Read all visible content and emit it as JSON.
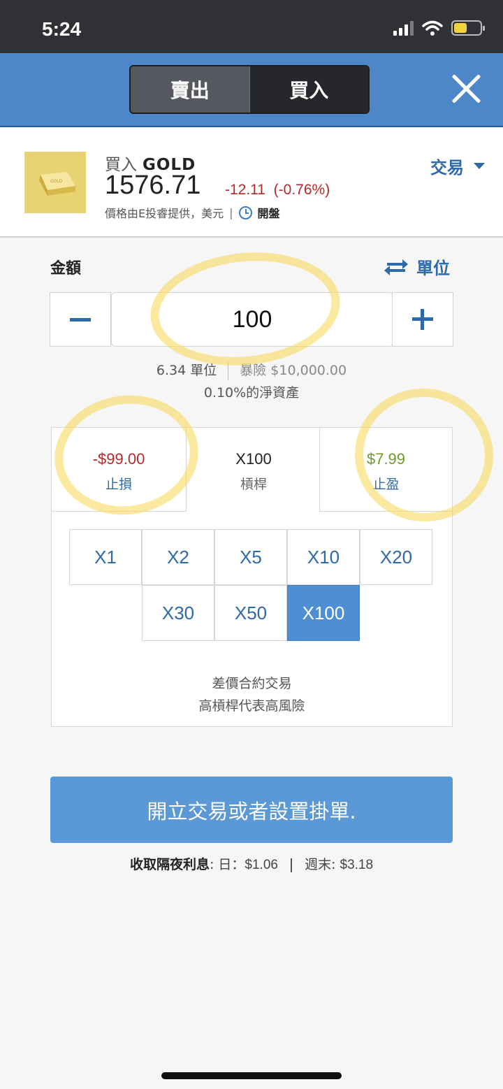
{
  "status_bar": {
    "time": "5:24"
  },
  "header": {
    "sell_label": "賣出",
    "buy_label": "買入"
  },
  "instrument": {
    "action": "買入",
    "symbol": "GOLD",
    "price": "1576.71",
    "change": "-12.11",
    "change_pct": "(-0.76%)",
    "source": "價格由E投睿提供，美元",
    "separator": "|",
    "market_status": "開盤",
    "trade_menu": "交易",
    "logo_text": "GOLD"
  },
  "amount": {
    "label": "金額",
    "unit_toggle": "單位",
    "value": "100",
    "units": "6.34 單位",
    "exposure": "暴險 $10,000.00",
    "equity": "0.10%的淨資產"
  },
  "panel": {
    "stop_loss_value": "-$99.00",
    "stop_loss_label": "止損",
    "leverage_value": "X100",
    "leverage_label": "槓桿",
    "take_profit_value": "$7.99",
    "take_profit_label": "止盈",
    "leverage_options": [
      "X1",
      "X2",
      "X5",
      "X10",
      "X20",
      "X30",
      "X50",
      "X100"
    ],
    "selected_leverage": "X100",
    "cfd_line1": "差價合約交易",
    "cfd_line2": "高槓桿代表高風險"
  },
  "actions": {
    "open_trade": "開立交易或者設置掛單.",
    "overnight_label": "收取隔夜利息",
    "overnight_colon": ":",
    "day_label": "日：",
    "day_value": "$1.06",
    "weekend_label": "週末:",
    "weekend_value": "$3.18"
  },
  "colors": {
    "header_blue": "#4d87c7",
    "accent_blue": "#2f6aa8",
    "loss_red": "#b22a2a",
    "profit_green": "#6f9a2a",
    "highlight_yellow": "#f6d750"
  }
}
